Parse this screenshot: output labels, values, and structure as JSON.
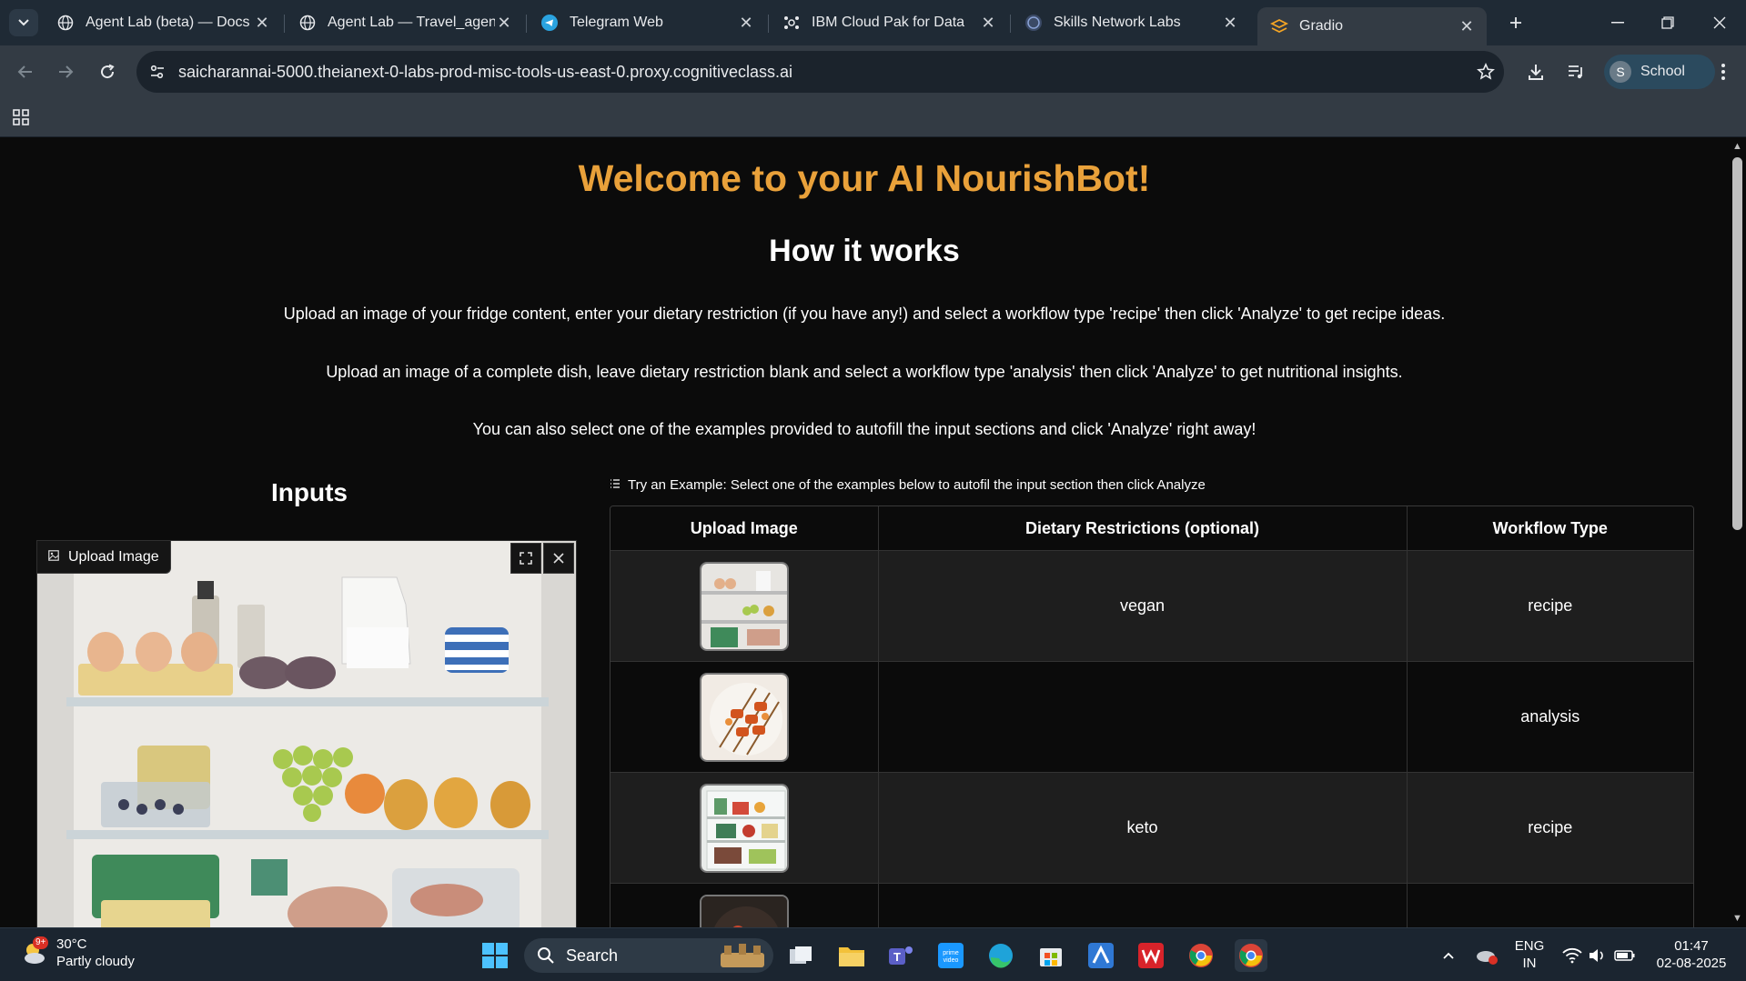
{
  "browser": {
    "tabs": [
      {
        "title": "Agent Lab (beta) — Docs |",
        "icon": "globe-icon",
        "active": false
      },
      {
        "title": "Agent Lab — Travel_agent",
        "icon": "globe-icon",
        "active": false
      },
      {
        "title": "Telegram Web",
        "icon": "telegram-icon",
        "active": false
      },
      {
        "title": "IBM Cloud Pak for Data",
        "icon": "ibm-icon",
        "active": false
      },
      {
        "title": "Skills Network Labs",
        "icon": "skills-network-icon",
        "active": false
      },
      {
        "title": "Gradio",
        "icon": "gradio-icon",
        "active": true
      }
    ],
    "url": "saicharannai-5000.theianext-0-labs-prod-misc-tools-us-east-0.proxy.cognitiveclass.ai",
    "profile": {
      "initial": "S",
      "label": "School"
    }
  },
  "page": {
    "title": "Welcome to your AI NourishBot!",
    "subtitle": "How it works",
    "paragraphs": [
      "Upload an image of your fridge content, enter your dietary restriction (if you have any!) and select a workflow type 'recipe' then click 'Analyze' to get recipe ideas.",
      "Upload an image of a complete dish, leave dietary restriction blank and select a workflow type 'analysis' then click 'Analyze' to get nutritional insights.",
      "You can also select one of the examples provided to autofill the input sections and click 'Analyze' right away!"
    ],
    "inputs_heading": "Inputs",
    "upload_label": "Upload Image",
    "examples_label": "Try an Example: Select one of the examples below to autofil the input section then click Analyze",
    "examples_table": {
      "headers": [
        "Upload Image",
        "Dietary Restrictions (optional)",
        "Workflow Type"
      ],
      "rows": [
        {
          "dietary": "vegan",
          "workflow": "recipe"
        },
        {
          "dietary": "",
          "workflow": "analysis"
        },
        {
          "dietary": "keto",
          "workflow": "recipe"
        },
        {
          "dietary": "",
          "workflow": ""
        }
      ]
    },
    "accent_color": "#e9a13a"
  },
  "taskbar": {
    "weather": {
      "temp": "30°C",
      "desc": "Partly cloudy",
      "badge": "9+"
    },
    "search_placeholder": "Search",
    "lang": {
      "line1": "ENG",
      "line2": "IN"
    },
    "time": "01:47",
    "date": "02-08-2025"
  }
}
